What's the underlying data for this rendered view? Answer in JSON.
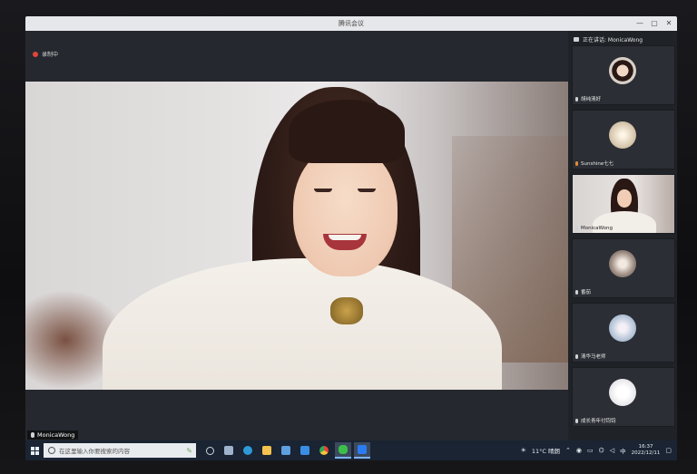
{
  "window": {
    "title": "腾讯会议",
    "controls": [
      "—",
      "▢",
      "✕"
    ]
  },
  "recording": {
    "label": "录制中"
  },
  "main_video": {
    "speaker_name": "MonicaWong"
  },
  "panel": {
    "speaking_label": "正在讲话: MonicaWong",
    "participants": [
      {
        "name": "胡纯清好",
        "has_video": false,
        "avatar_color": "#c7b8a7"
      },
      {
        "name": "Sunshine七七",
        "has_video": false,
        "avatar_color": "#d8c9b0"
      },
      {
        "name": "MonicaWong",
        "has_video": true,
        "avatar_color": "#2a1814"
      },
      {
        "name": "番茄",
        "has_video": false,
        "avatar_color": "#c9c3bd"
      },
      {
        "name": "清华马老师",
        "has_video": false,
        "avatar_color": "#b7c6d8"
      },
      {
        "name": "成长青年付钧钧",
        "has_video": false,
        "avatar_color": "#e6e6ea"
      }
    ]
  },
  "taskbar": {
    "search_placeholder": "在这里输入你要搜索的内容",
    "apps": [
      {
        "name": "task-view",
        "color": "#cfd6de"
      },
      {
        "name": "widgets",
        "color": "#9fb3cc"
      },
      {
        "name": "edge",
        "color": "#2f9ad8"
      },
      {
        "name": "file-explorer",
        "color": "#f2c14e"
      },
      {
        "name": "store",
        "color": "#5fa0e0"
      },
      {
        "name": "mail",
        "color": "#3a8ee6"
      },
      {
        "name": "chrome",
        "color": "#e4463a"
      },
      {
        "name": "wechat",
        "color": "#3cbf4a"
      },
      {
        "name": "tencent-meeting",
        "color": "#2b7cf2"
      }
    ],
    "weather": "11°C 晴朗",
    "ime": "中",
    "time": "16:37",
    "date": "2022/12/11"
  }
}
